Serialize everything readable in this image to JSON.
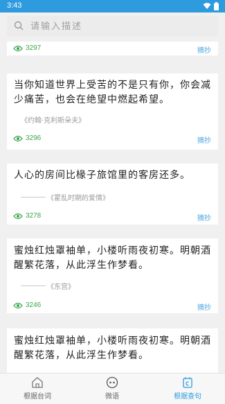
{
  "status": {
    "time": "3:43"
  },
  "search": {
    "placeholder": "请输入描述"
  },
  "cards": [
    {
      "views": "3297",
      "copy": "摘抄"
    },
    {
      "quote": "当你知道世界上受苦的不是只有你，你会减少痛苦，也会在绝望中燃起希望。",
      "source": "《约翰·克利斯朵夫》",
      "views": "3296",
      "copy": "摘抄"
    },
    {
      "quote": "人心的房间比椽子旅馆里的客房还多。",
      "source": "《霍乱时期的爱情》",
      "views": "3278",
      "copy": "摘抄"
    },
    {
      "quote": "蜜烛红烛罩袖单，小楼听雨夜初寒。明朝酒醒繁花落，从此浮生作梦看。",
      "source": "《东宫》",
      "views": "3246",
      "copy": "摘抄"
    },
    {
      "quote": "蜜烛红烛罩袖单，小楼听雨夜初寒。明朝酒醒繁花落，从此浮生作梦看。"
    }
  ],
  "tabs": [
    {
      "label": "根据台词"
    },
    {
      "label": "微语"
    },
    {
      "label": "根据查句"
    }
  ],
  "colors": {
    "accent": "#2f9bdf",
    "views_green": "#3aa64a",
    "copy_blue": "#4aa4df"
  }
}
